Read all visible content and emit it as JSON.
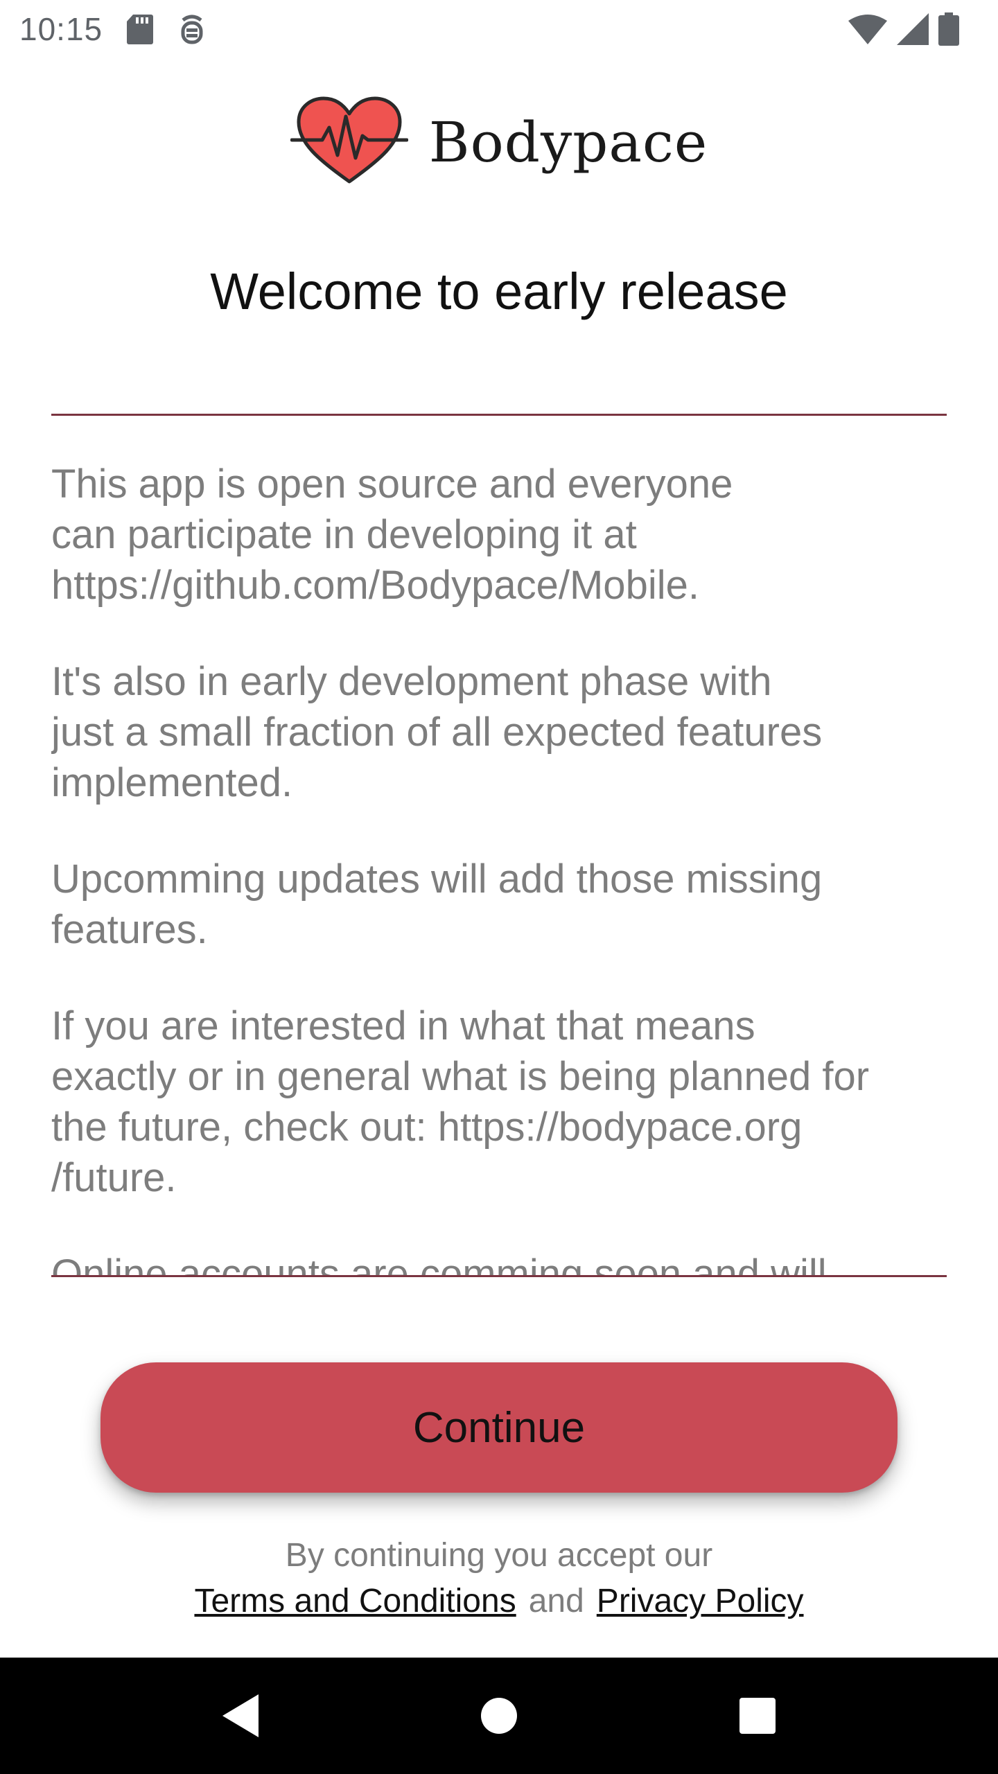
{
  "status_bar": {
    "time": "10:15",
    "icons": [
      "sd-card-icon",
      "debug-icon",
      "wifi-icon",
      "signal-icon",
      "battery-icon"
    ]
  },
  "brand": {
    "name": "Bodypace",
    "logo_icon": "heart-pulse-icon",
    "logo_color": "#ef5350"
  },
  "title": "Welcome to early release",
  "content": {
    "paragraphs": [
      {
        "lines": [
          "This app is open source and everyone",
          "can participate in developing it at",
          "https://github.com/Bodypace/Mobile."
        ]
      },
      {
        "lines": [
          "It's also in early development phase with",
          "just a small fraction of all expected features",
          "implemented."
        ]
      },
      {
        "lines": [
          "Upcomming updates will add those missing",
          "features."
        ]
      },
      {
        "lines": [
          "If you are interested in what that means",
          "exactly or in general what is being planned for",
          "the future, check out: https://bodypace.org",
          "/future."
        ]
      },
      {
        "lines": [
          "Online accounts are comming soon and will"
        ]
      }
    ]
  },
  "continue_button": {
    "label": "Continue",
    "color": "#c94a55"
  },
  "legal": {
    "prefix": "By continuing you accept our",
    "terms_label": "Terms and Conditions",
    "and": "and",
    "privacy_label": "Privacy Policy"
  },
  "nav_bar": {
    "back_icon": "back-triangle-icon",
    "home_icon": "home-circle-icon",
    "recents_icon": "recents-square-icon"
  }
}
